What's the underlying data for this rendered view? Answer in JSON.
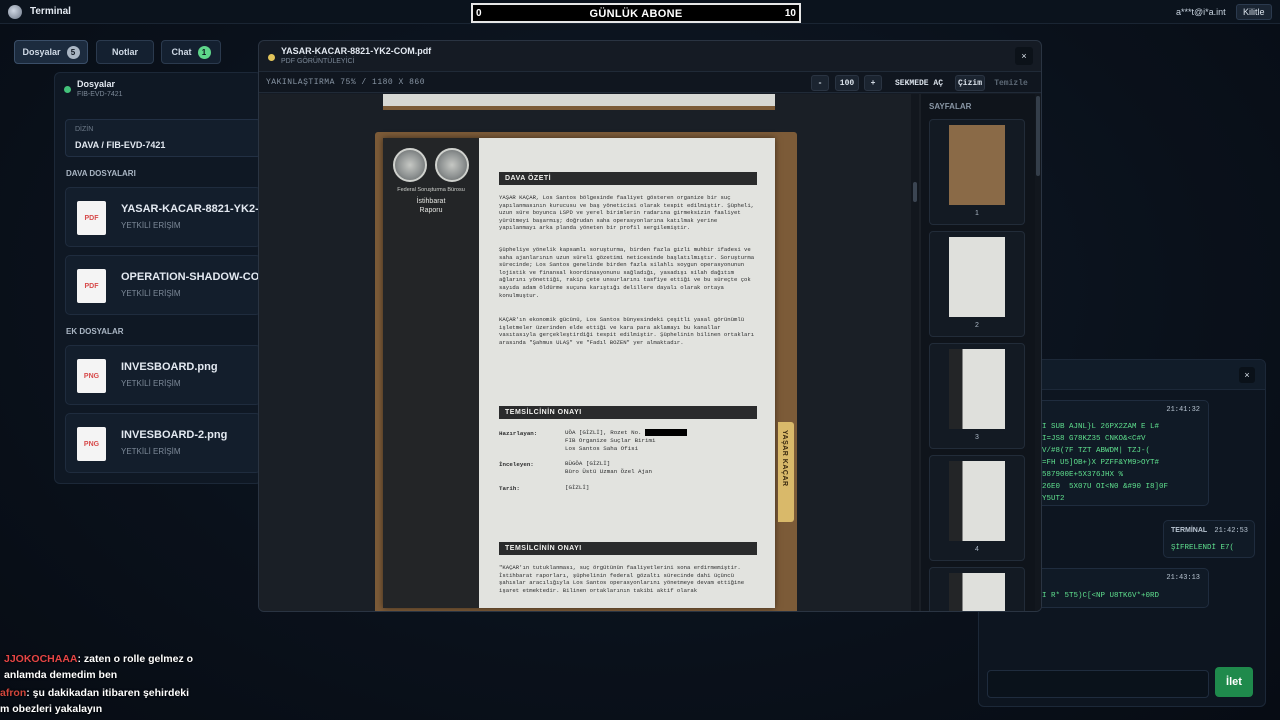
{
  "topbar": {
    "app_title": "Terminal",
    "counter_min": "0",
    "counter_label": "GÜNLÜK ABONE",
    "counter_max": "10",
    "counter_progress": 0,
    "user_email": "a***t@i*a.int",
    "lock_label": "Kilitle"
  },
  "tabs": [
    {
      "label": "Dosyalar",
      "badge": "5"
    },
    {
      "label": "Notlar"
    },
    {
      "label": "Chat",
      "badge": "1"
    }
  ],
  "files_panel": {
    "title": "Dosyalar",
    "case_id": "FIB-EVD-7421",
    "dir_label": "DİZİN",
    "dir_value": "DAVA / FIB-EVD-7421",
    "case_files_label": "DAVA DOSYALARI",
    "extra_files_label": "EK DOSYALAR",
    "case_files": [
      {
        "type": "PDF",
        "name": "YASAR-KACAR-8821-YK2-",
        "access": "YETKİLİ ERİŞİM"
      },
      {
        "type": "PDF",
        "name": "OPERATION-SHADOW-CO",
        "access": "YETKİLİ ERİŞİM"
      }
    ],
    "extra_files": [
      {
        "type": "PNG",
        "name": "INVESBOARD.png",
        "access": "YETKİLİ ERİŞİM"
      },
      {
        "type": "PNG",
        "name": "INVESBOARD-2.png",
        "access": "YETKİLİ ERİŞİM"
      }
    ]
  },
  "pdf_viewer": {
    "title": "YASAR-KACAR-8821-YK2-COM.pdf",
    "subtitle": "PDF GÖRÜNTÜLEYİCİ",
    "close_label": "×",
    "zoom_info": "YAKINLAŞTIRMA 75% / 1180 X 860",
    "toolbar": {
      "zoom_out": "-",
      "zoom_value": "100",
      "zoom_in": "+",
      "open_tab": "SEKMEDE AÇ",
      "draw": "Çizim",
      "clear": "Temizle"
    },
    "pages_label": "SAYFALAR",
    "page_numbers": [
      "1",
      "2",
      "3",
      "4"
    ]
  },
  "document": {
    "agency": "Federal Soruşturma Bürosu",
    "report_title_1": "İstihbarat",
    "report_title_2": "Raporu",
    "section_summary": "DAVA ÖZETİ",
    "para1": "YAŞAR KAÇAR, Los Santos bölgesinde faaliyet gösteren organize bir suç yapılanmasının kurucusu ve baş yöneticisi olarak tespit edilmiştir. Şüpheli, uzun süre boyunca LSPD ve yerel birimlerin radarına girmeksizin faaliyet yürütmeyi başarmış; doğrudan saha operasyonlarına katılmak yerine yapılanmayı arka planda yöneten bir profil sergilemiştir.",
    "para2": "Şüpheliye yönelik kapsamlı soruşturma, birden fazla gizli muhbir ifadesi ve saha ajanlarının uzun süreli gözetimi neticesinde başlatılmıştır. Soruşturma sürecinde; Los Santos genelinde birden fazla silahlı soygun operasyonunun lojistik ve finansal koordinasyonunu sağladığı, yasadışı silah dağıtım ağlarını yönettiği, rakip çete unsurlarını tasfiye ettiği ve bu süreçte çok sayıda adam öldürme suçuna karıştığı delillere dayalı olarak ortaya konulmuştur.",
    "para3": "KAÇAR'ın ekonomik gücünü, Los Santos bünyesindeki çeşitli yasal görünümlü işletmeler üzerinden elde ettiği ve kara para aklamayı bu kanallar vasıtasıyla gerçekleştirdiği tespit edilmiştir. Şüphelinin bilinen ortakları arasında \"Şahmus ULAŞ\" ve \"Fadıl BOZEN\" yer almaktadır.",
    "section_approval": "TEMSİLCİNİN ONAYI",
    "prepared_label": "Hazırlayan:",
    "prepared_1": "UÖA [GİZLİ], Rozet No.",
    "prepared_2": "FIB Organize Suçlar Birimi",
    "prepared_3": "Los Santos Saha Ofisi",
    "reviewed_label": "İnceleyen:",
    "reviewed_1": "BÜGÖA [GİZLİ]",
    "reviewed_2": "Büro Üstü Uzman Özel Ajan",
    "date_label": "Tarih:",
    "date_value": "[GİZLİ]",
    "section_approval_2": "TEMSİLCİNİN ONAYI",
    "para4": "\"KAÇAR'ın tutuklanması, suç örgütünün faaliyetlerini sona erdirmemiştir. İstihbarat raporları, şüphelinin federal gözaltı sürecinde dahi üçüncü şahıslar aracılığıyla Los Santos operasyonlarını yönetmeye devam ettiğine işaret etmektedir. Bilinen ortaklarının takibi aktif olarak",
    "tab_label": "YAŞAR KAÇAR"
  },
  "chat_window": {
    "close_label": "×",
    "messages": [
      {
        "time": "21:41:32",
        "lines": [
          "I SUB AJNL}L 26PX2ZAM E L#",
          "I=JS8 G78KZ35 CNKO&<C#V",
          "V/#8(7F TZT ABWDM| TZJ-(",
          "=FH U5]OB+)X PZFF&YM9>OYT#",
          "587900E+5X376JHX %",
          "26E0  5X07U OI<N0 &#90 I8]0F",
          "Y5UT2"
        ]
      },
      {
        "sender": "TERMİNAL",
        "time": "21:42:53",
        "lines": [
          "ŞİFRELENDİ E7("
        ]
      },
      {
        "time": "21:43:13",
        "lines": [
          "I R* 5T5)C[<NP U8TK6V*+0RD"
        ]
      }
    ],
    "send_label": "İlet"
  },
  "stream_chat": [
    {
      "user": "JJOKOCHAAA",
      "text": ": zaten o rolle gelmez o"
    },
    {
      "text": "anlamda demedim ben"
    },
    {
      "user": "afron",
      "text": ": şu dakikadan itibaren şehirdeki"
    },
    {
      "text": "m obezleri yakalayın"
    }
  ]
}
